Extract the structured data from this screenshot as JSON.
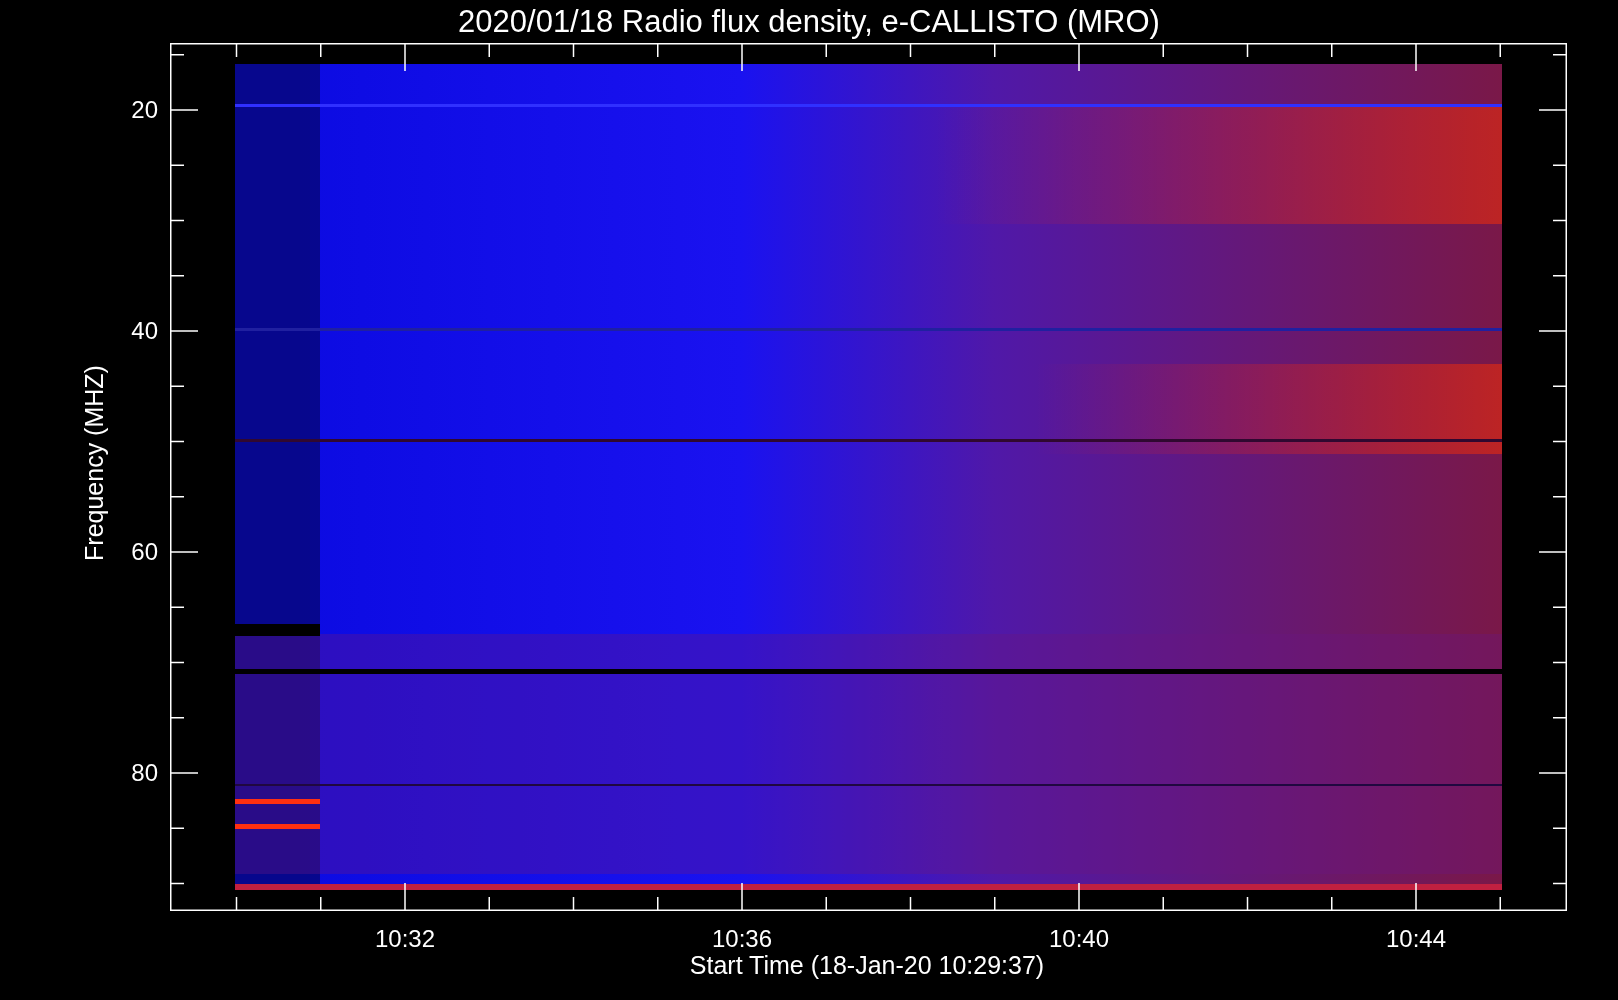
{
  "title": "2020/01/18  Radio flux density, e-CALLISTO (MRO)",
  "y_axis": {
    "label": "Frequency (MHZ)",
    "ticks": [
      "20",
      "40",
      "60",
      "80"
    ]
  },
  "x_axis": {
    "label": "Start Time (18-Jan-20 10:29:37)",
    "ticks": [
      "10:32",
      "10:36",
      "10:40",
      "10:44"
    ]
  }
}
